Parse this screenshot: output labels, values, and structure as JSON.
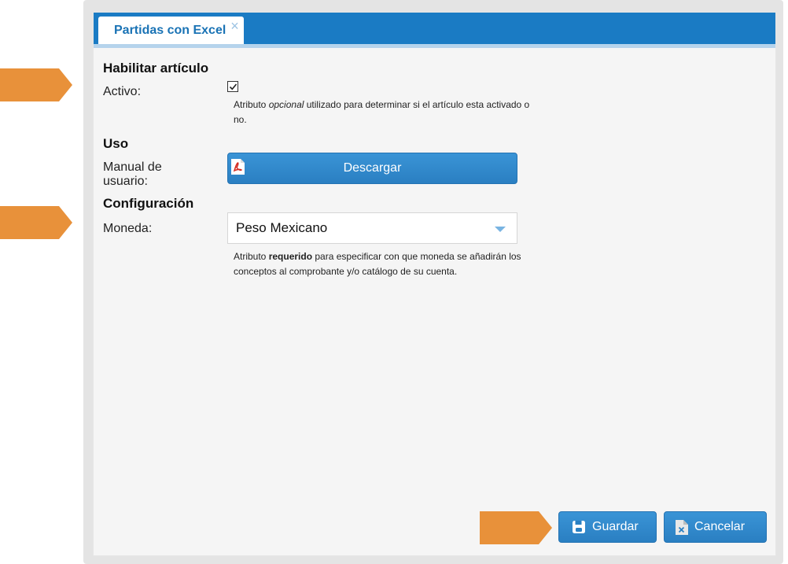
{
  "tab": {
    "label": "Partidas con Excel",
    "close_glyph": "×",
    "close_icon": "close-icon"
  },
  "sections": {
    "habilitar": {
      "title": "Habilitar artículo",
      "activo_label": "Activo:",
      "activo_checked": true,
      "help_prefix": "Atributo ",
      "help_emphasis": "opcional",
      "help_suffix": " utilizado para determinar si el artículo esta activado o no."
    },
    "uso": {
      "title": "Uso",
      "manual_label_line1": "Manual de",
      "manual_label_line2": "usuario:",
      "download_button": "Descargar",
      "download_icon": "pdf-icon"
    },
    "configuracion": {
      "title": "Configuración",
      "moneda_label": "Moneda:",
      "moneda_value": "Peso Mexicano",
      "help_prefix": "Atributo ",
      "help_strong": "requerido",
      "help_suffix": " para especificar con que moneda se añadirán los conceptos al comprobante y/o catálogo de su cuenta."
    }
  },
  "footer": {
    "save_label": "Guardar",
    "save_icon": "floppy-disk-icon",
    "cancel_label": "Cancelar",
    "cancel_icon": "file-cancel-icon"
  },
  "markers": {
    "color": "#e8913a"
  },
  "colors": {
    "accent": "#1a7bc4",
    "button": "#2a86c8",
    "tab_text": "#1a73b5"
  }
}
